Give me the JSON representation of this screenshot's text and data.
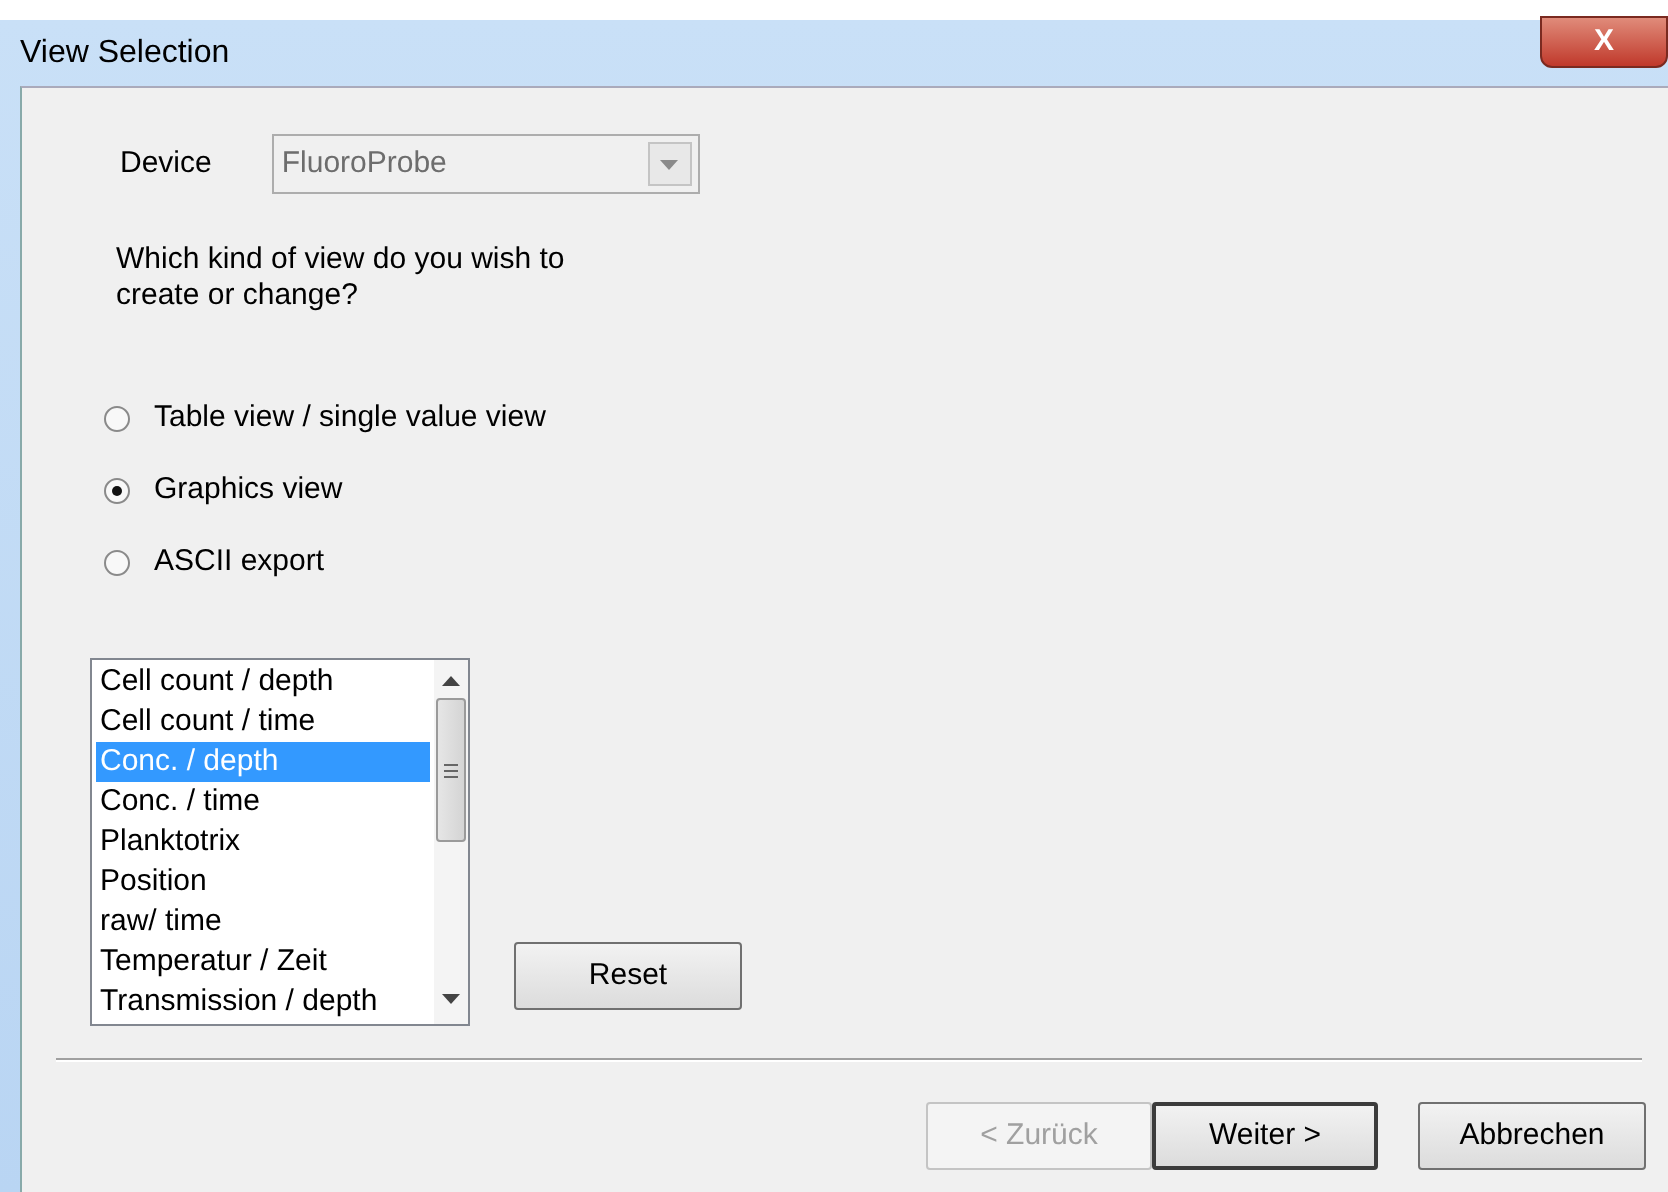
{
  "window": {
    "title": "View Selection",
    "close": "X"
  },
  "device": {
    "label": "Device",
    "value": "FluoroProbe",
    "disabled": true
  },
  "question": "Which kind of view do you wish to create or change?",
  "view_options": [
    {
      "label": "Table view / single value view",
      "selected": false
    },
    {
      "label": "Graphics view",
      "selected": true
    },
    {
      "label": "ASCII export",
      "selected": false
    }
  ],
  "views": [
    {
      "label": "Cell count / depth",
      "selected": false
    },
    {
      "label": "Cell count / time",
      "selected": false
    },
    {
      "label": "Conc. / depth",
      "selected": true
    },
    {
      "label": "Conc. / time",
      "selected": false
    },
    {
      "label": "Planktotrix",
      "selected": false
    },
    {
      "label": "Position",
      "selected": false
    },
    {
      "label": "raw/ time",
      "selected": false
    },
    {
      "label": "Temperatur / Zeit",
      "selected": false
    },
    {
      "label": "Transmission / depth",
      "selected": false
    }
  ],
  "reset_button": "Reset",
  "buttons": [
    {
      "label": "< Zurück",
      "disabled": true,
      "default": false
    },
    {
      "label": "Weiter >",
      "disabled": false,
      "default": true
    },
    {
      "label": "Abbrechen",
      "disabled": false,
      "default": false
    }
  ]
}
